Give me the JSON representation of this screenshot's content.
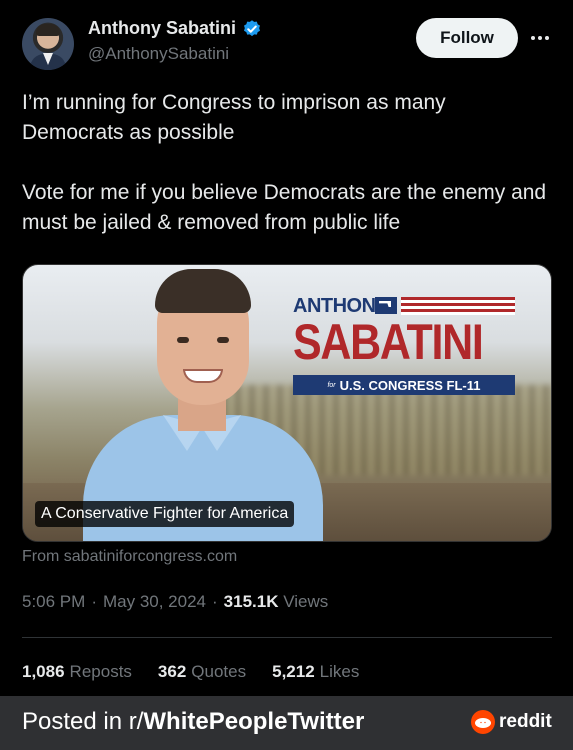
{
  "author": {
    "display_name": "Anthony Sabatini",
    "handle": "@AnthonySabatini",
    "verified": true
  },
  "header": {
    "follow_label": "Follow",
    "more_icon": "more-horizontal-icon"
  },
  "tweet": {
    "paragraphs": [
      "I’m running for Congress to imprison as many Democrats as possible",
      "Vote for me if you believe Democrats are the enemy and must be jailed & removed from public life"
    ]
  },
  "media": {
    "logo_first_name": "ANTHONY",
    "logo_last_name": "SABATINI",
    "logo_for": "for",
    "logo_office": "U.S. CONGRESS FL-11",
    "caption": "A Conservative Fighter for America"
  },
  "source": "From sabatiniforcongress.com",
  "meta": {
    "time": "5:06 PM",
    "sep1": "·",
    "date": "May 30, 2024",
    "sep2": "·",
    "views_count": "315.1K",
    "views_label": "Views"
  },
  "stats": {
    "reposts_count": "1,086",
    "reposts_label": "Reposts",
    "quotes_count": "362",
    "quotes_label": "Quotes",
    "likes_count": "5,212",
    "likes_label": "Likes"
  },
  "footer": {
    "posted_prefix": "Posted in r/",
    "subreddit": "WhitePeopleTwitter",
    "brand": "reddit"
  },
  "colors": {
    "background": "#000000",
    "text": "#e7e9ea",
    "muted": "#71767b",
    "verified_blue": "#1d9bf0",
    "reddit_orange": "#ff4500"
  }
}
